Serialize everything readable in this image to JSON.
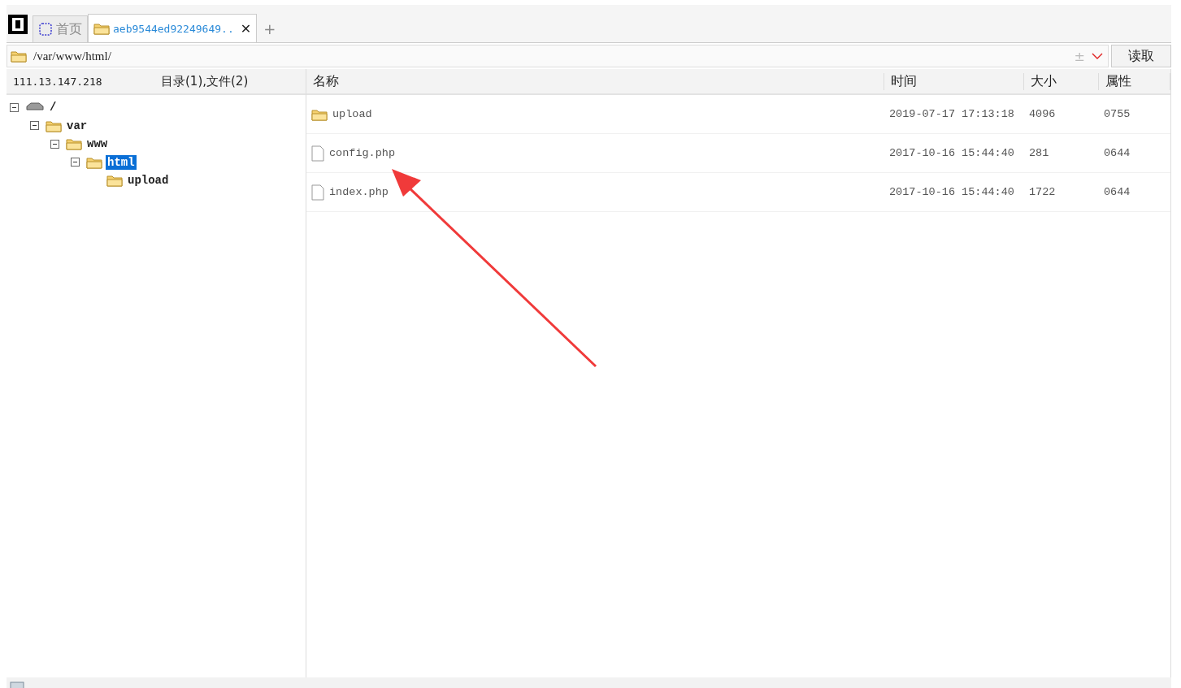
{
  "tabs": [
    {
      "kind": "home",
      "label": "首页",
      "selected": false
    },
    {
      "kind": "folder",
      "label": "aeb9544ed92249649..",
      "selected": true,
      "close": "✕"
    }
  ],
  "new_tab": "+",
  "address": {
    "path": "/var/www/html/",
    "extra": "±"
  },
  "read_button": "读取",
  "host": "111.13.147.218",
  "summary": "目录(1),文件(2)",
  "tree": [
    {
      "kind": "drive",
      "label": "/",
      "expanded": true,
      "selected": false,
      "children": [
        {
          "kind": "folder",
          "label": "var",
          "expanded": true,
          "selected": false,
          "children": [
            {
              "kind": "folder",
              "label": "www",
              "expanded": true,
              "selected": false,
              "children": [
                {
                  "kind": "folder",
                  "label": "html",
                  "expanded": true,
                  "selected": true,
                  "children": [
                    {
                      "kind": "folder",
                      "label": "upload",
                      "selected": false
                    }
                  ]
                }
              ]
            }
          ]
        }
      ]
    }
  ],
  "columns": [
    "名称",
    "时间",
    "大小",
    "属性"
  ],
  "files": [
    {
      "kind": "folder",
      "name": "upload",
      "time": "2019-07-17 17:13:18",
      "size": "4096",
      "perm": "0755"
    },
    {
      "kind": "file",
      "name": "config.php",
      "time": "2017-10-16 15:44:40",
      "size": "281",
      "perm": "0644"
    },
    {
      "kind": "file",
      "name": "index.php",
      "time": "2017-10-16 15:44:40",
      "size": "1722",
      "perm": "0644"
    }
  ]
}
